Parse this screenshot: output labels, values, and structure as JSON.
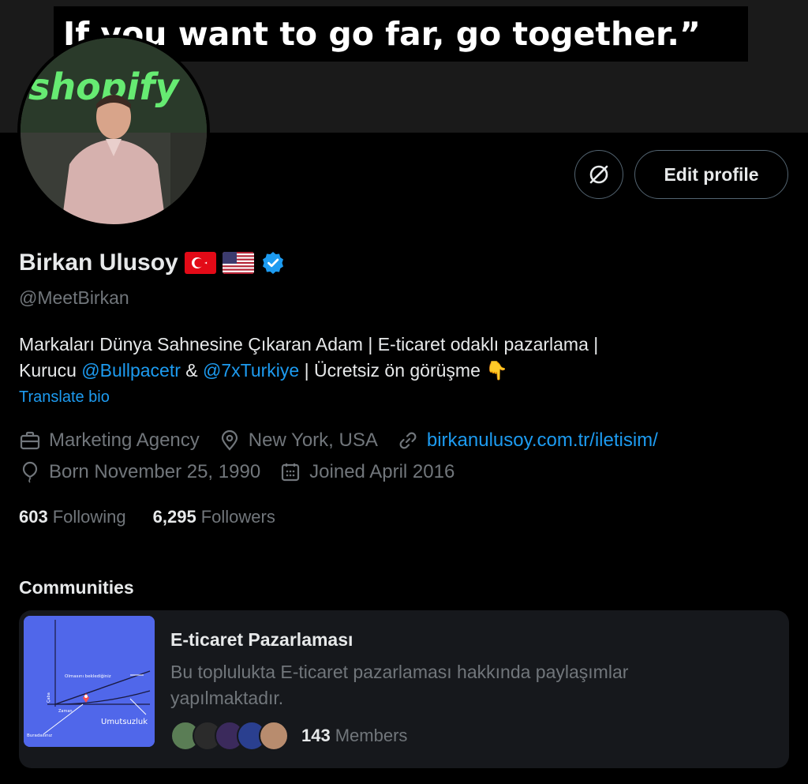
{
  "banner": {
    "quote": "If you want to go far, go together.”"
  },
  "profile": {
    "name": "Birkan Ulusoy",
    "handle": "@MeetBirkan",
    "flags": [
      "turkey-flag",
      "usa-flag"
    ],
    "verified_color": "#1d9bf0",
    "avatar_sign_text": "shopify"
  },
  "actions": {
    "edit_profile_label": "Edit profile",
    "icon_button": "no-grok-icon"
  },
  "bio": {
    "line1": "Markaları Dünya Sahnesine Çıkaran Adam | E-ticaret odaklı pazarlama |",
    "line2_prefix": "Kurucu ",
    "mention1": "@Bullpacetr",
    "connector": " & ",
    "mention2": "@7xTurkiye",
    "line2_suffix": " | Ücretsiz ön görüşme 👇",
    "translate_label": "Translate bio"
  },
  "meta": {
    "category": "Marketing Agency",
    "location": "New York, USA",
    "website": "birkanulusoy.com.tr/iletisim/",
    "birth": "Born November 25, 1990",
    "joined": "Joined April 2016"
  },
  "stats": {
    "following_count": "603",
    "following_label": "Following",
    "followers_count": "6,295",
    "followers_label": "Followers"
  },
  "communities": {
    "title": "Communities",
    "items": [
      {
        "name": "E-ticaret Pazarlaması",
        "description": "Bu toplulukta E-ticaret pazarlaması hakkında paylaşımlar yapılmaktadır.",
        "members_count": "143",
        "members_label": "Members",
        "thumb_labels": {
          "expected": "Olmasını beklediğiniz",
          "axis_y": "Çaba",
          "axis_x": "Zaman",
          "despair": "Umutsuzluk",
          "here": "Buradasınız"
        }
      }
    ]
  },
  "colors": {
    "accent": "#1d9bf0",
    "background": "#000000",
    "card": "#16181c",
    "muted": "#71767b"
  }
}
